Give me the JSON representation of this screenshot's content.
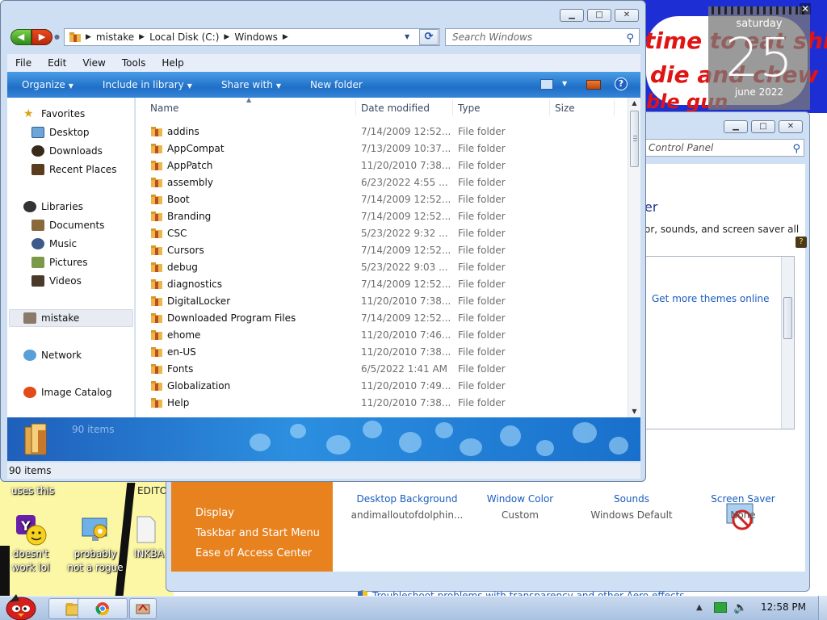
{
  "desktop": {
    "wallpaper_lines": [
      "time to eat shi",
      "die and chew",
      "ble gun"
    ],
    "icons": [
      {
        "label": "doesn't work lol"
      },
      {
        "label": "probably not a rogue"
      },
      {
        "label": "INKBA"
      }
    ],
    "partial_labels": [
      "uses this",
      "EDITO"
    ]
  },
  "calendar": {
    "day": "saturday",
    "date": "25",
    "month": "june 2022"
  },
  "explorer": {
    "address": {
      "crumbs": [
        "mistake",
        "Local Disk (C:)",
        "Windows"
      ]
    },
    "search_placeholder": "Search Windows",
    "menu": [
      "File",
      "Edit",
      "View",
      "Tools",
      "Help"
    ],
    "commands": [
      "Organize",
      "Include in library",
      "Share with",
      "New folder"
    ],
    "nav": {
      "favorites": "Favorites",
      "desktop": "Desktop",
      "downloads": "Downloads",
      "recent": "Recent Places",
      "libraries": "Libraries",
      "documents": "Documents",
      "music": "Music",
      "pictures": "Pictures",
      "videos": "Videos",
      "homegroup": "mistake",
      "network": "Network",
      "catalog": "Image Catalog"
    },
    "columns": {
      "name": "Name",
      "date": "Date modified",
      "type": "Type",
      "size": "Size"
    },
    "files": [
      {
        "name": "addins",
        "date": "7/14/2009 12:52...",
        "type": "File folder"
      },
      {
        "name": "AppCompat",
        "date": "7/13/2009 10:37...",
        "type": "File folder"
      },
      {
        "name": "AppPatch",
        "date": "11/20/2010 7:38...",
        "type": "File folder"
      },
      {
        "name": "assembly",
        "date": "6/23/2022 4:55 ...",
        "type": "File folder"
      },
      {
        "name": "Boot",
        "date": "7/14/2009 12:52...",
        "type": "File folder"
      },
      {
        "name": "Branding",
        "date": "7/14/2009 12:52...",
        "type": "File folder"
      },
      {
        "name": "CSC",
        "date": "5/23/2022 9:32 ...",
        "type": "File folder"
      },
      {
        "name": "Cursors",
        "date": "7/14/2009 12:52...",
        "type": "File folder"
      },
      {
        "name": "debug",
        "date": "5/23/2022 9:03 ...",
        "type": "File folder"
      },
      {
        "name": "diagnostics",
        "date": "7/14/2009 12:52...",
        "type": "File folder"
      },
      {
        "name": "DigitalLocker",
        "date": "11/20/2010 7:38...",
        "type": "File folder"
      },
      {
        "name": "Downloaded Program Files",
        "date": "7/14/2009 12:52...",
        "type": "File folder"
      },
      {
        "name": "ehome",
        "date": "11/20/2010 7:46...",
        "type": "File folder"
      },
      {
        "name": "en-US",
        "date": "11/20/2010 7:38...",
        "type": "File folder"
      },
      {
        "name": "Fonts",
        "date": "6/5/2022 1:41 AM",
        "type": "File folder"
      },
      {
        "name": "Globalization",
        "date": "11/20/2010 7:49...",
        "type": "File folder"
      },
      {
        "name": "Help",
        "date": "11/20/2010 7:38...",
        "type": "File folder"
      }
    ],
    "details_count": "90 items",
    "status": "90 items"
  },
  "control_panel": {
    "search_placeholder": "Control Panel",
    "heading_partial": "er",
    "desc_partial": "or, sounds, and screen saver all",
    "more_themes": "Get more themes online",
    "left_links": [
      "Display",
      "Taskbar and Start Menu",
      "Ease of Access Center"
    ],
    "items": [
      {
        "label": "Desktop Background",
        "value": "andimalloutofdolphin..."
      },
      {
        "label": "Window Color",
        "value": "Custom"
      },
      {
        "label": "Sounds",
        "value": "Windows Default"
      },
      {
        "label": "Screen Saver",
        "value": "None"
      }
    ],
    "troubleshoot": "Troubleshoot problems with transparency and other Aero effects"
  },
  "taskbar": {
    "clock": "12:58 PM"
  },
  "colors": {
    "accent_blue": "#1f6fc7",
    "link_blue": "#1a5dbf",
    "cp_orange": "#e8821f",
    "wallpaper_red": "#e11414"
  }
}
